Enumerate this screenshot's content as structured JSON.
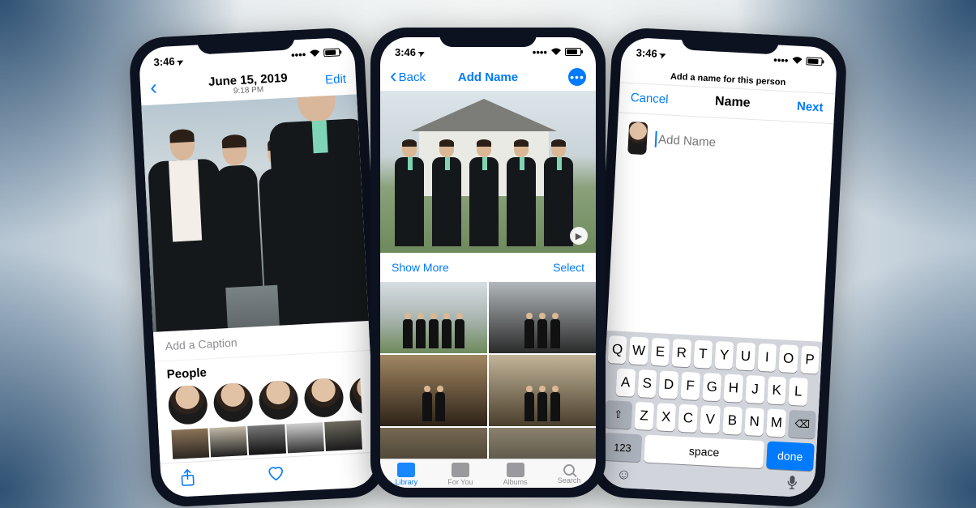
{
  "status": {
    "time": "3:46",
    "subtitle_photo": "9:18 PM"
  },
  "phone1": {
    "date_title": "June 15, 2019",
    "edit": "Edit",
    "caption_placeholder": "Add a Caption",
    "people_header": "People"
  },
  "phone2": {
    "back": "Back",
    "title": "Add Name",
    "show_more": "Show More",
    "select": "Select",
    "tabs": {
      "library": "Library",
      "foryou": "For You",
      "albums": "Albums",
      "search": "Search"
    }
  },
  "phone3": {
    "prompt": "Add a name for this person",
    "cancel": "Cancel",
    "title": "Name",
    "next": "Next",
    "placeholder": "Add Name",
    "keys_r1": [
      "Q",
      "W",
      "E",
      "R",
      "T",
      "Y",
      "U",
      "I",
      "O",
      "P"
    ],
    "keys_r2": [
      "A",
      "S",
      "D",
      "F",
      "G",
      "H",
      "J",
      "K",
      "L"
    ],
    "keys_r3": [
      "Z",
      "X",
      "C",
      "V",
      "B",
      "N",
      "M"
    ],
    "num": "123",
    "space": "space",
    "done": "done"
  }
}
